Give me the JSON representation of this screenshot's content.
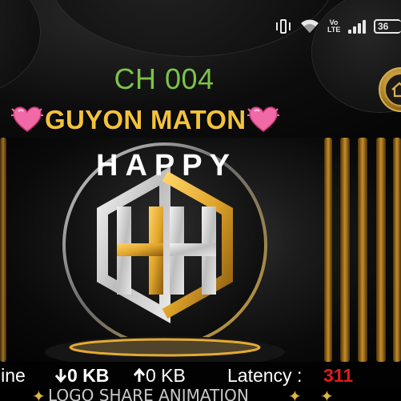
{
  "status_bar": {
    "battery_level": "36",
    "volte": "Vo LTE",
    "icons": [
      "vibrate-icon",
      "wifi-icon",
      "volte-icon",
      "signal-icon",
      "battery-icon"
    ]
  },
  "header": {
    "channel": "CH 004",
    "host_name": "GUYON MATON",
    "emoji_icon": "heart-emoji-icon",
    "home_icon": "home-icon"
  },
  "stage": {
    "brand_word": "HAPPY",
    "logo_icon": "hh-hexagon-logo"
  },
  "stats": {
    "online_label": "line",
    "download": "0 KB",
    "upload": "0 KB",
    "latency_label": "Latency :",
    "latency_value": "311"
  },
  "ticker": {
    "text": "LOGO SHARE ANIMATION"
  },
  "colors": {
    "channel_green": "#7cc24a",
    "host_gold": "#f3c23c",
    "latency_red": "#e11b1b",
    "logo_gold": "#e0a52a",
    "logo_silver": "#d9d9d9"
  }
}
